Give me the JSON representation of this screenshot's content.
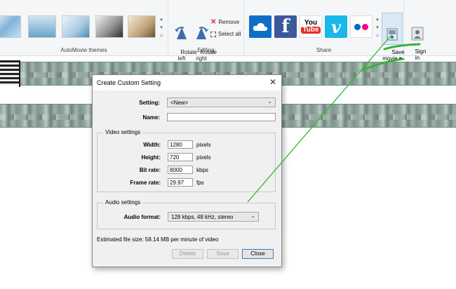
{
  "ribbon": {
    "themes_group_label": "AutoMovie themes",
    "editing": {
      "group_label": "Editing",
      "rotate_left": "Rotate\nleft",
      "rotate_right": "Rotate\nright",
      "remove": "Remove",
      "select_all": "Select all"
    },
    "share": {
      "group_label": "Share",
      "youtube_you": "You",
      "youtube_tube": "Tube",
      "facebook_glyph": "f",
      "vimeo_glyph": "v",
      "save_movie": "Save\nmovie ▾",
      "sign_in": "Sign\nin"
    }
  },
  "dialog": {
    "title": "Create Custom Setting",
    "setting_label": "Setting:",
    "setting_value": "<New>",
    "name_label": "Name:",
    "name_value": "",
    "video_settings": {
      "legend": "Video settings",
      "width_label": "Width:",
      "width_value": "1280",
      "width_unit": "pixels",
      "height_label": "Height:",
      "height_value": "720",
      "height_unit": "pixels",
      "bitrate_label": "Bit rate:",
      "bitrate_value": "8000",
      "bitrate_unit": "kbps",
      "framerate_label": "Frame rate:",
      "framerate_value": "29.97",
      "framerate_unit": "fps"
    },
    "audio_settings": {
      "legend": "Audio settings",
      "format_label": "Audio format:",
      "format_value": "128 kbps, 48 kHz, stereo"
    },
    "estimated_size": "Estimated file size: 58.14 MB per minute of video",
    "buttons": {
      "delete": "Delete",
      "save": "Save",
      "close": "Close"
    }
  },
  "colors": {
    "annotation": "#33b534",
    "accent": "#3d7bbf"
  }
}
